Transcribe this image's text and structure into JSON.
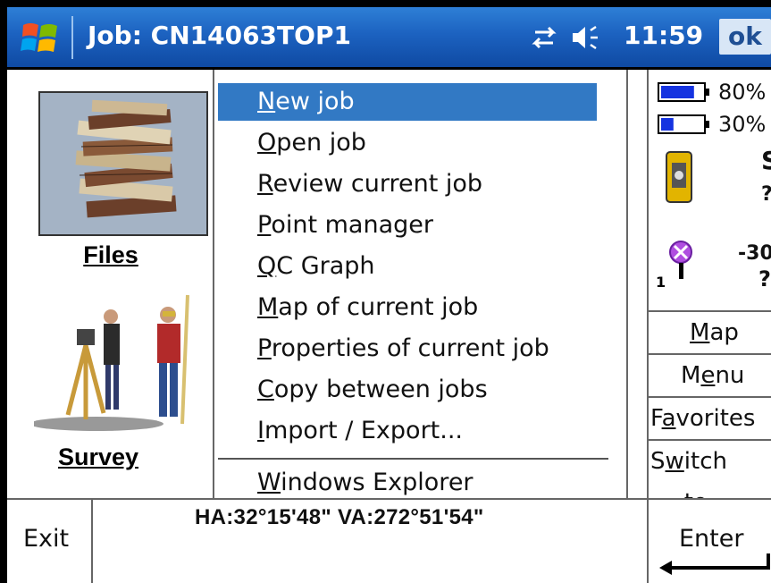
{
  "titlebar": {
    "title": "Job: CN14063TOP1",
    "time": "11:59",
    "ok_label": "ok"
  },
  "tiles": {
    "files_label": "Files",
    "survey_label": "Survey"
  },
  "menu": {
    "items": [
      {
        "label": "New job",
        "selected": true
      },
      {
        "label": "Open job"
      },
      {
        "label": "Review current job"
      },
      {
        "label": "Point manager"
      },
      {
        "label": "QC Graph"
      },
      {
        "label": "Map of current job"
      },
      {
        "label": "Properties of current job"
      },
      {
        "label": "Copy between jobs"
      },
      {
        "label": "Import / Export..."
      },
      {
        "label": "Windows Explorer"
      }
    ]
  },
  "status": {
    "battery1": "80%",
    "battery1_level": 0.8,
    "battery2": "30%",
    "battery2_level": 0.3,
    "instrument_status": "S",
    "instrument_q": "?",
    "target_value": "-30",
    "target_q": "?",
    "target_num": "1"
  },
  "side_buttons": {
    "map": "Map",
    "menu": "Menu",
    "favorites": "Favorites",
    "switch_to": "Switch to"
  },
  "bottom": {
    "exit": "Exit",
    "angles": "HA:32°15'48\"  VA:272°51'54\"",
    "enter": "Enter"
  },
  "colors": {
    "titlebar": "#1c62c0",
    "selection": "#3279c4",
    "battery_fill": "#1533e0"
  }
}
